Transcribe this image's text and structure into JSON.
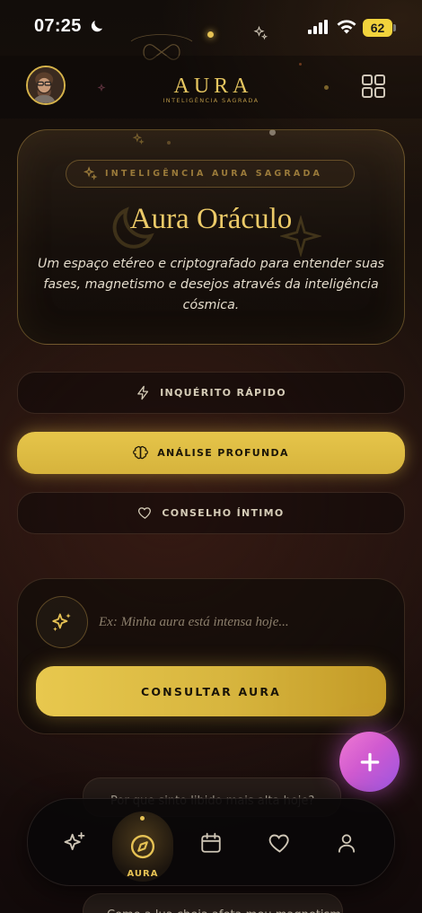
{
  "status_bar": {
    "time": "07:25",
    "battery": "62",
    "moon_icon": "moon-icon",
    "signal_icon": "cellular-signal-icon",
    "wifi_icon": "wifi-icon"
  },
  "header": {
    "title": "AURA",
    "subtitle": "INTELIGÊNCIA SAGRADA",
    "avatar_icon": "user-avatar",
    "menu_icon": "grid-icon"
  },
  "oracle": {
    "badge": "INTELIGÊNCIA AURA SAGRADA",
    "title": "Aura Oráculo",
    "description": "Um espaço etéreo e criptografado para entender suas fases, magnetismo e desejos através da inteligência cósmica."
  },
  "modes": [
    {
      "label": "INQUÉRITO RÁPIDO",
      "icon": "lightning-icon",
      "active": false
    },
    {
      "label": "ANÁLISE PROFUNDA",
      "icon": "brain-icon",
      "active": true
    },
    {
      "label": "CONSELHO ÍNTIMO",
      "icon": "heart-icon",
      "active": false
    }
  ],
  "consult": {
    "placeholder": "Ex: Minha aura está intensa hoje...",
    "value": "",
    "button": "CONSULTAR AURA",
    "icon": "sparkles-icon"
  },
  "fab": {
    "icon": "plus-icon"
  },
  "peek_cards": [
    "Por que sinto libido mais alta hoje?",
    "Como a lua cheia afeta meu magnetismo?"
  ],
  "nav": {
    "items": [
      {
        "icon": "sparkles-icon",
        "label": ""
      },
      {
        "icon": "compass-icon",
        "label": "AURA"
      },
      {
        "icon": "calendar-icon",
        "label": ""
      },
      {
        "icon": "heart-icon",
        "label": ""
      },
      {
        "icon": "user-icon",
        "label": ""
      }
    ],
    "active_index": 1
  },
  "colors": {
    "gold": "#e6c254",
    "dark_background": "#1a110c",
    "fab_pink": "#e070d4",
    "fab_purple": "#9a55e0"
  }
}
